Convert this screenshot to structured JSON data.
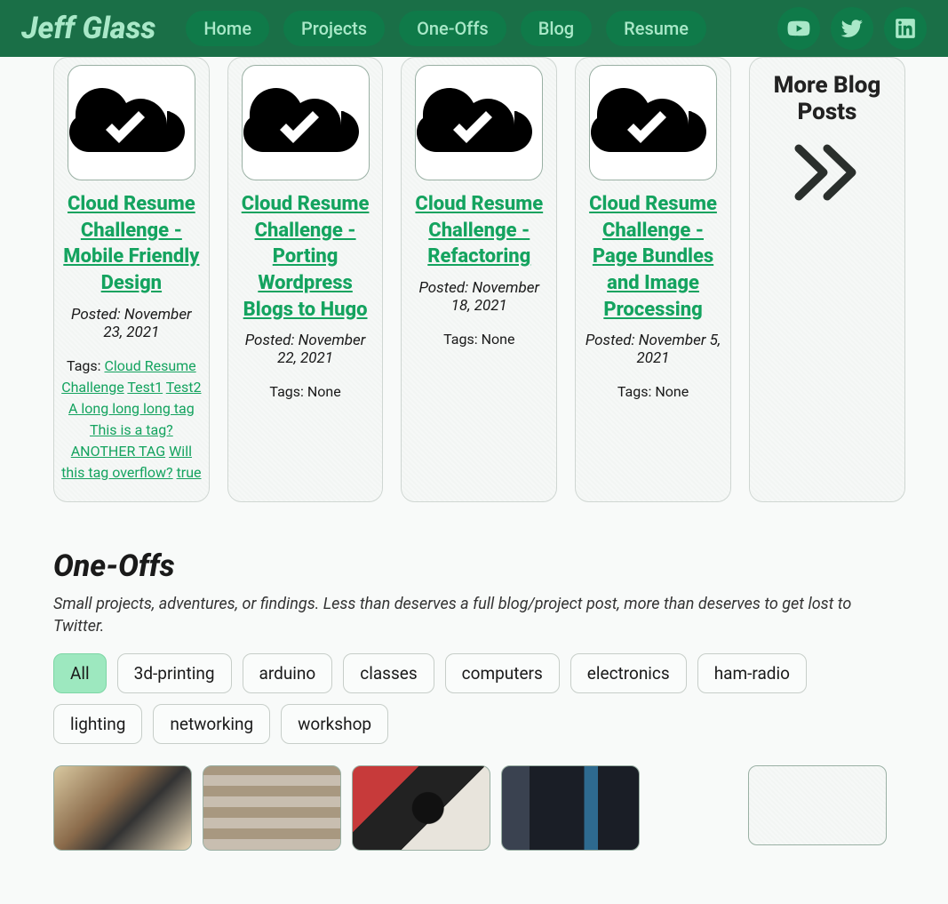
{
  "nav": {
    "brand": "Jeff Glass",
    "links": [
      "Home",
      "Projects",
      "One-Offs",
      "Blog",
      "Resume"
    ]
  },
  "blog": {
    "cards": [
      {
        "title": "Cloud Resume Challenge - Mobile Friendly Design",
        "date": "Posted: November 23, 2021",
        "tags_label": "Tags: ",
        "tags": [
          "Cloud Resume Challenge",
          "Test1",
          "Test2",
          "A long long long tag",
          "This is a tag?",
          "ANOTHER TAG",
          "Will this tag overflow?",
          "true"
        ]
      },
      {
        "title": "Cloud Resume Challenge - Porting Wordpress Blogs to Hugo",
        "date": "Posted: November 22, 2021",
        "tags_none": "Tags: None"
      },
      {
        "title": "Cloud Resume Challenge - Refactoring",
        "date": "Posted: November 18, 2021",
        "tags_none": "Tags: None"
      },
      {
        "title": "Cloud Resume Challenge - Page Bundles and Image Processing",
        "date": "Posted: November 5, 2021",
        "tags_none": "Tags: None"
      }
    ],
    "more": "More Blog Posts"
  },
  "oneoffs": {
    "heading": "One-Offs",
    "sub": "Small projects, adventures, or findings. Less than deserves a full blog/project post, more than deserves to get lost to Twitter.",
    "filters": [
      "All",
      "3d-printing",
      "arduino",
      "classes",
      "computers",
      "electronics",
      "ham-radio",
      "lighting",
      "networking",
      "workshop"
    ],
    "active_filter_index": 0
  }
}
